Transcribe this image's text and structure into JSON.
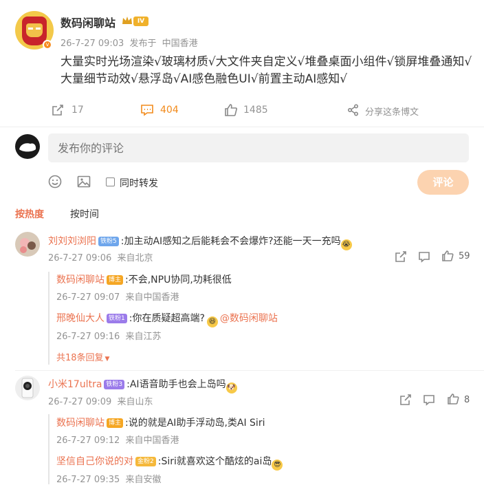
{
  "post": {
    "username": "数码闲聊站",
    "level": "IV",
    "time": "26-7-27 09:03",
    "source_prefix": "发布于",
    "source": "中国香港",
    "content_line1": "大量实时光场渲染√玻璃材质√大文件夹自定义√堆叠桌面小组件√锁屏堆叠通知√",
    "content_line2": "大量细节动效√悬浮岛√AI感色融色UI√前置主动AI感知√",
    "repost_count": "17",
    "comment_count": "404",
    "like_count": "1485",
    "share_label": "分享这条博文"
  },
  "composer": {
    "placeholder": "发布你的评论",
    "repost_label": "同时转发",
    "submit_label": "评论"
  },
  "sort": {
    "hot_label": "按热度",
    "time_label": "按时间"
  },
  "comments": [
    {
      "name": "刘刘刘浏阳",
      "badge": "铁粉5",
      "text": ":加主动AI感知之后能耗会不会爆炸?还能一天一充吗",
      "time": "26-7-27 09:06",
      "location": "来自北京",
      "likes": "59",
      "replies": [
        {
          "name": "数码闲聊站",
          "badge": "博主",
          "text": ":不会,NPU协同,功耗很低",
          "time": "26-7-27 09:07",
          "location": "来自中国香港"
        },
        {
          "name": "邢晚仙大人",
          "badge": "铁粉1",
          "text": ":你在质疑超高端?",
          "mention": "@数码闲聊站",
          "time": "26-7-27 09:16",
          "location": "来自江苏"
        }
      ],
      "more_replies": "共18条回复"
    },
    {
      "name": "小米17ultra",
      "badge": "铁粉3",
      "text": ":AI语音助手也会上岛吗",
      "time": "26-7-27 09:09",
      "location": "来自山东",
      "likes": "8",
      "replies": [
        {
          "name": "数码闲聊站",
          "badge": "博主",
          "text": ":说的就是AI助手浮动岛,类AI Siri",
          "time": "26-7-27 09:12",
          "location": "来自中国香港"
        },
        {
          "name": "坚信自己你说的对",
          "badge": "金粉2",
          "text": ":Siri就喜欢这个酷炫的ai岛",
          "time": "26-7-27 09:35",
          "location": "来自安徽"
        }
      ]
    }
  ],
  "colors": {
    "accent_orange": "#f28a1a",
    "name_orange": "#eb7350",
    "submit_button": "#fcd3b0",
    "fan_badge_blue": "#6ea6ec",
    "fan_badge_purple": "#9b7bea",
    "blogger_badge": "#f5a623",
    "gold_badge": "#f5b83a"
  },
  "icons": [
    "repost-icon",
    "comment-icon",
    "like-icon",
    "share-icon",
    "emoji-icon",
    "image-icon",
    "chevron-down-icon"
  ]
}
